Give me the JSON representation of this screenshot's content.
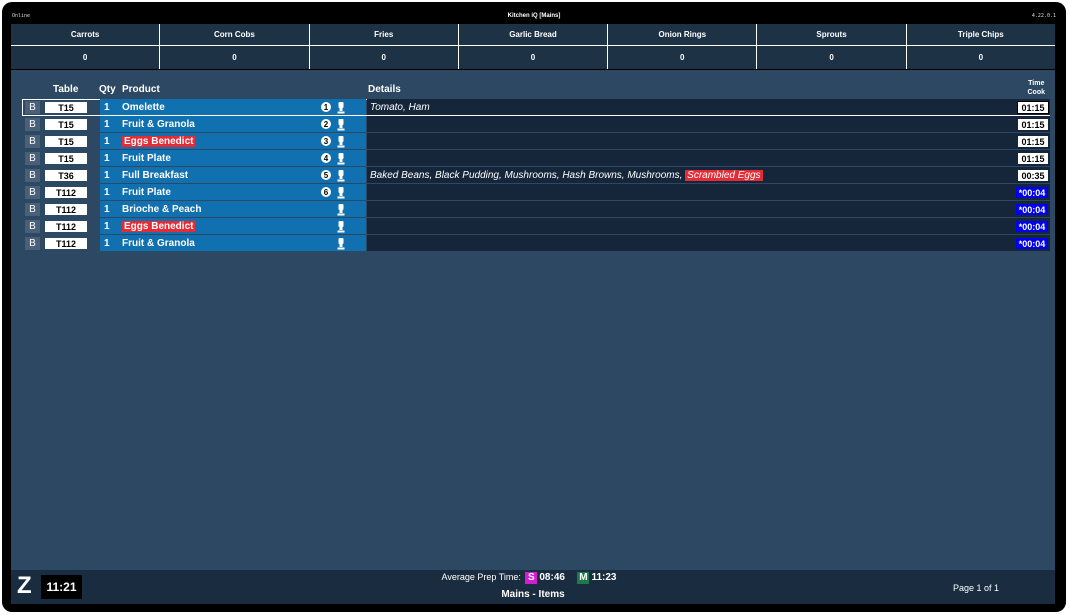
{
  "status": "Online",
  "title": "Kitchen iQ [Mains]",
  "version": "4.22.0.1",
  "counts": [
    {
      "name": "Carrots",
      "value": "0"
    },
    {
      "name": "Corn Cobs",
      "value": "0"
    },
    {
      "name": "Fries",
      "value": "0"
    },
    {
      "name": "Garlic Bread",
      "value": "0"
    },
    {
      "name": "Onion Rings",
      "value": "0"
    },
    {
      "name": "Sprouts",
      "value": "0"
    },
    {
      "name": "Triple Chips",
      "value": "0"
    }
  ],
  "headers": {
    "table": "Table",
    "qty": "Qty",
    "product": "Product",
    "details": "Details",
    "time_line1": "Time",
    "time_line2": "Cook"
  },
  "rows": [
    {
      "b": "B",
      "table": "T15",
      "qty": "1",
      "product": "Omelette",
      "highlight": false,
      "seq": "1",
      "details": "Tomato, Ham",
      "details_hl": "",
      "time": "01:15",
      "over": false,
      "selected": true
    },
    {
      "b": "B",
      "table": "T15",
      "qty": "1",
      "product": "Fruit & Granola",
      "highlight": false,
      "seq": "2",
      "details": "",
      "details_hl": "",
      "time": "01:15",
      "over": false,
      "selected": false
    },
    {
      "b": "B",
      "table": "T15",
      "qty": "1",
      "product": "Eggs Benedict",
      "highlight": true,
      "seq": "3",
      "details": "",
      "details_hl": "",
      "time": "01:15",
      "over": false,
      "selected": false
    },
    {
      "b": "B",
      "table": "T15",
      "qty": "1",
      "product": "Fruit Plate",
      "highlight": false,
      "seq": "4",
      "details": "",
      "details_hl": "",
      "time": "01:15",
      "over": false,
      "selected": false
    },
    {
      "b": "B",
      "table": "T36",
      "qty": "1",
      "product": "Full Breakfast",
      "highlight": false,
      "seq": "5",
      "details": "Baked Beans, Black Pudding, Mushrooms, Hash Browns, Mushrooms, ",
      "details_hl": "Scrambled Eggs",
      "time": "00:35",
      "over": false,
      "selected": false
    },
    {
      "b": "B",
      "table": "T112",
      "qty": "1",
      "product": "Fruit Plate",
      "highlight": false,
      "seq": "6",
      "details": "",
      "details_hl": "",
      "time": "*00:04",
      "over": true,
      "selected": false
    },
    {
      "b": "B",
      "table": "T112",
      "qty": "1",
      "product": "Brioche & Peach",
      "highlight": false,
      "seq": "",
      "details": "",
      "details_hl": "",
      "time": "*00:04",
      "over": true,
      "selected": false
    },
    {
      "b": "B",
      "table": "T112",
      "qty": "1",
      "product": "Eggs Benedict",
      "highlight": true,
      "seq": "",
      "details": "",
      "details_hl": "",
      "time": "*00:04",
      "over": true,
      "selected": false
    },
    {
      "b": "B",
      "table": "T112",
      "qty": "1",
      "product": "Fruit & Granola",
      "highlight": false,
      "seq": "",
      "details": "",
      "details_hl": "",
      "time": "*00:04",
      "over": true,
      "selected": false
    }
  ],
  "footer": {
    "logo": "Z",
    "clock": "11:21",
    "prep_label": "Average Prep Time:",
    "s_badge": "S",
    "s_time": "08:46",
    "m_badge": "M",
    "m_time": "11:23",
    "screen_name": "Mains - Items",
    "page": "Page 1 of 1"
  },
  "icons": {
    "chef": "chef-hat-icon"
  },
  "colors": {
    "row_blue": "#1170b0",
    "highlight_red": "#e52b36",
    "overdue_blue": "#0000ee",
    "s_badge": "#d21ed2",
    "m_badge": "#1e7a4a"
  }
}
